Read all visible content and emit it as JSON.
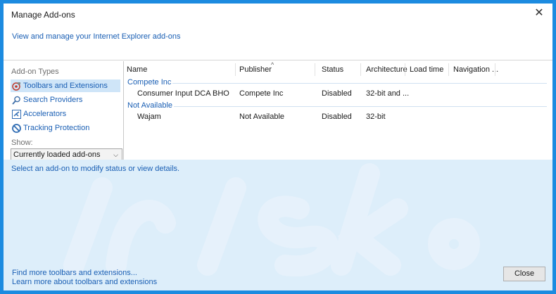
{
  "window": {
    "title": "Manage Add-ons",
    "close_glyph": "✕"
  },
  "header": {
    "link_text": "View and manage your Internet Explorer add-ons"
  },
  "sidebar": {
    "heading": "Add-on Types",
    "items": [
      {
        "label": "Toolbars and Extensions",
        "icon": "toolbar-gear-icon",
        "selected": true
      },
      {
        "label": "Search Providers",
        "icon": "search-icon",
        "selected": false
      },
      {
        "label": "Accelerators",
        "icon": "accelerator-icon",
        "selected": false
      },
      {
        "label": "Tracking Protection",
        "icon": "no-entry-icon",
        "selected": false
      }
    ],
    "show_label": "Show:",
    "show_value": "Currently loaded add-ons"
  },
  "table": {
    "columns": [
      "Name",
      "Publisher",
      "Status",
      "Architecture",
      "Load time",
      "Navigation ..."
    ],
    "groups": [
      {
        "name": "Compete Inc",
        "rows": [
          {
            "name": "Consumer Input DCA BHO",
            "publisher": "Compete Inc",
            "status": "Disabled",
            "architecture": "32-bit and ..."
          }
        ]
      },
      {
        "name": "Not Available",
        "rows": [
          {
            "name": "Wajam",
            "publisher": "Not Available",
            "status": "Disabled",
            "architecture": "32-bit"
          }
        ]
      }
    ]
  },
  "details": {
    "prompt": "Select an add-on to modify status or view details.",
    "links": [
      "Find more toolbars and extensions...",
      "Learn more about toolbars and extensions"
    ],
    "close_label": "Close"
  },
  "colors": {
    "accent": "#1a5fb4",
    "frame": "#1c8be0",
    "details_bg": "#ddeefa",
    "selected_bg": "#cfe5f8"
  }
}
